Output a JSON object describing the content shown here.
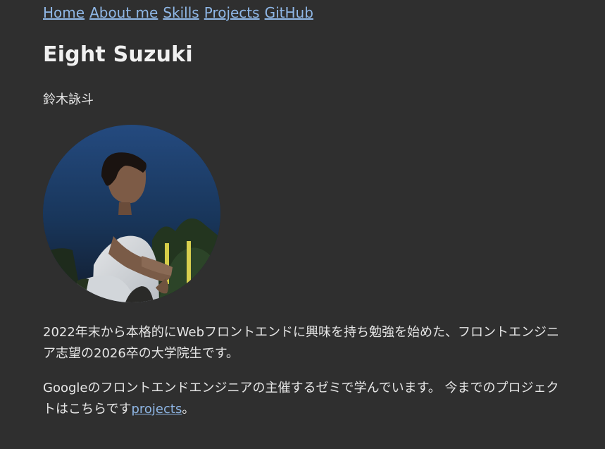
{
  "nav": {
    "home": "Home",
    "about": "About me",
    "skills": "Skills",
    "projects": "Projects",
    "github": "GitHub"
  },
  "profile": {
    "name": "Eight Suzuki",
    "japanese_name": "鈴木詠斗",
    "image": "profile-photo"
  },
  "content": {
    "paragraph1": "2022年末から本格的にWebフロントエンドに興味を持ち勉強を始めた、フロントエンジニア志望の2026卒の大学院生です。",
    "paragraph2_prefix": "Googleのフロントエンドエンジニアの主催するゼミで学んでいます。 今までのプロジェクトはこちらです",
    "projects_link": "projects",
    "paragraph2_suffix": "。"
  },
  "colors": {
    "background": "#2f2f2f",
    "text": "#e6e6e6",
    "link": "#8fb7e6"
  }
}
